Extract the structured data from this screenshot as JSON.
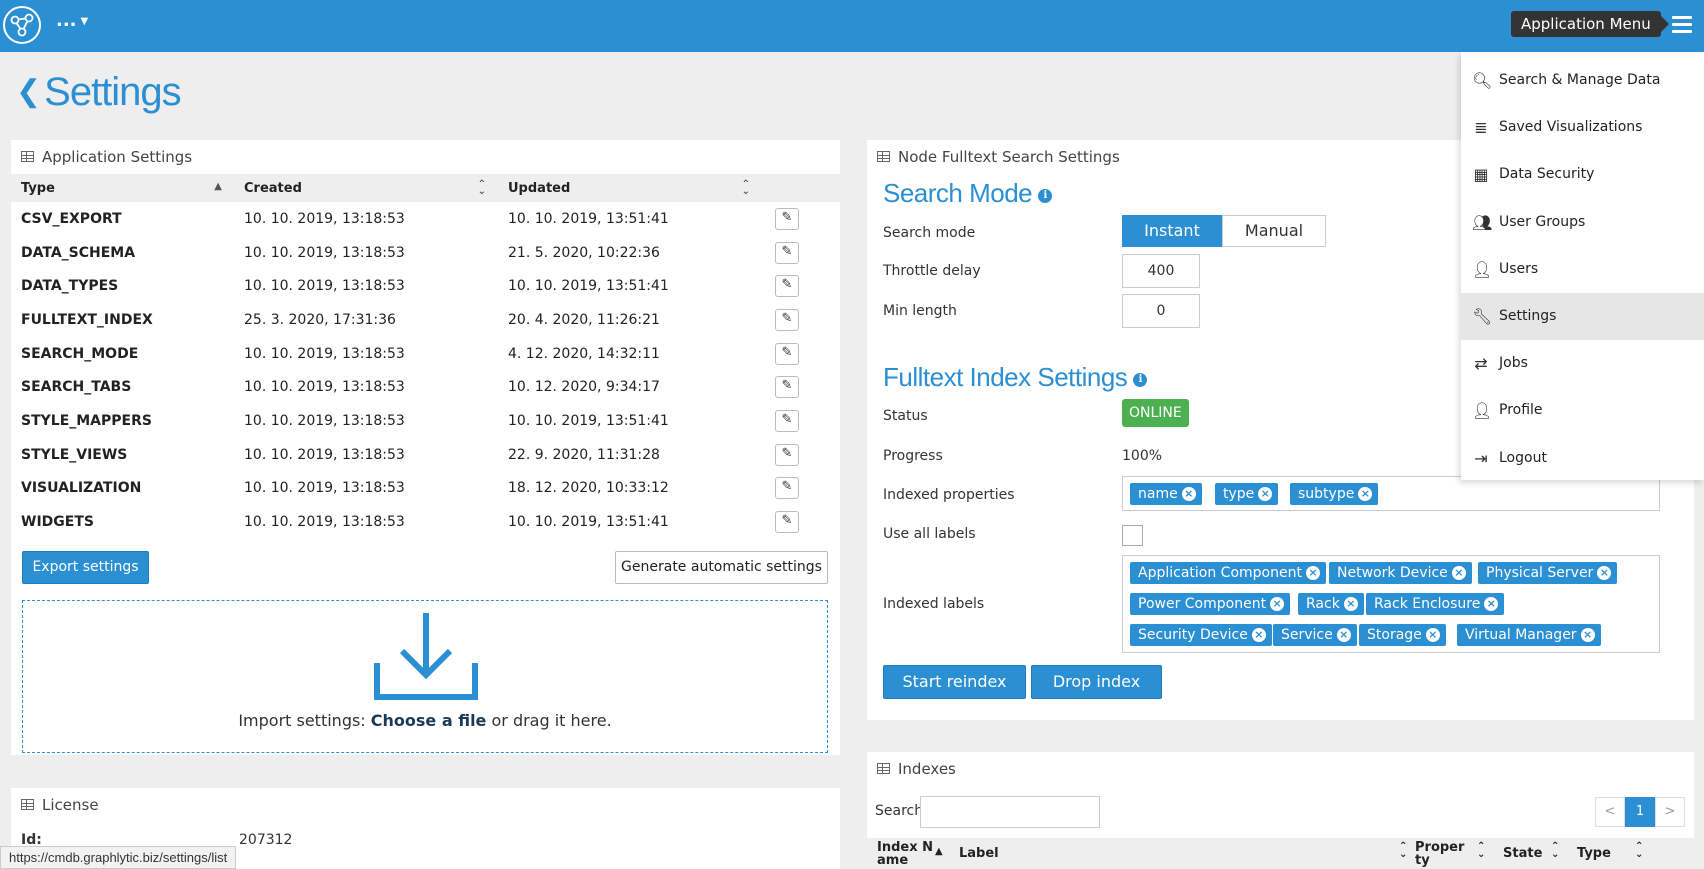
{
  "topbar": {
    "workspace_label": "...",
    "menu_tooltip": "Application Menu"
  },
  "page": {
    "title": "Settings"
  },
  "app_settings": {
    "title": "Application Settings",
    "columns": [
      "Type",
      "Created",
      "Updated"
    ],
    "rows": [
      {
        "type": "CSV_EXPORT",
        "created": "10. 10. 2019, 13:18:53",
        "updated": "10. 10. 2019, 13:51:41"
      },
      {
        "type": "DATA_SCHEMA",
        "created": "10. 10. 2019, 13:18:53",
        "updated": "21. 5. 2020, 10:22:36"
      },
      {
        "type": "DATA_TYPES",
        "created": "10. 10. 2019, 13:18:53",
        "updated": "10. 10. 2019, 13:51:41"
      },
      {
        "type": "FULLTEXT_INDEX",
        "created": "25. 3. 2020, 17:31:36",
        "updated": "20. 4. 2020, 11:26:21"
      },
      {
        "type": "SEARCH_MODE",
        "created": "10. 10. 2019, 13:18:53",
        "updated": "4. 12. 2020, 14:32:11"
      },
      {
        "type": "SEARCH_TABS",
        "created": "10. 10. 2019, 13:18:53",
        "updated": "10. 12. 2020, 9:34:17"
      },
      {
        "type": "STYLE_MAPPERS",
        "created": "10. 10. 2019, 13:18:53",
        "updated": "10. 10. 2019, 13:51:41"
      },
      {
        "type": "STYLE_VIEWS",
        "created": "10. 10. 2019, 13:18:53",
        "updated": "22. 9. 2020, 11:31:28"
      },
      {
        "type": "VISUALIZATION",
        "created": "10. 10. 2019, 13:18:53",
        "updated": "18. 12. 2020, 10:33:12"
      },
      {
        "type": "WIDGETS",
        "created": "10. 10. 2019, 13:18:53",
        "updated": "10. 10. 2019, 13:51:41"
      }
    ],
    "export_label": "Export settings",
    "generate_label": "Generate automatic settings",
    "import_prefix": "Import settings: ",
    "import_choose": "Choose a file",
    "import_suffix": " or drag it here."
  },
  "license": {
    "title": "License",
    "id_label": "Id:",
    "id_value": "207312"
  },
  "fulltext": {
    "panel_title": "Node Fulltext Search Settings",
    "search_mode_title": "Search Mode",
    "search_mode_label": "Search mode",
    "mode_instant": "Instant",
    "mode_manual": "Manual",
    "throttle_label": "Throttle delay",
    "throttle_value": "400",
    "min_length_label": "Min length",
    "min_length_value": "0",
    "index_title": "Fulltext Index Settings",
    "status_label": "Status",
    "status_value": "ONLINE",
    "progress_label": "Progress",
    "progress_value": "100%",
    "indexed_props_label": "Indexed properties",
    "indexed_props": [
      "name",
      "type",
      "subtype"
    ],
    "use_all_labels_label": "Use all labels",
    "indexed_labels_label": "Indexed labels",
    "indexed_labels": [
      "Application Component",
      "Network Device",
      "Physical Server",
      "Power Component",
      "Rack",
      "Rack Enclosure",
      "Security Device",
      "Service",
      "Storage",
      "Virtual Manager"
    ],
    "start_reindex_label": "Start reindex",
    "drop_index_label": "Drop index"
  },
  "indexes": {
    "title": "Indexes",
    "search_label": "Search",
    "search_value": "",
    "columns": [
      "Index N\name",
      "Label",
      "Proper\nty",
      "State",
      "Type"
    ],
    "pager_prev": "<",
    "pager_page": "1",
    "pager_next": ">"
  },
  "menu": {
    "items": [
      {
        "label": "Search & Manage Data",
        "icon": "search-icon"
      },
      {
        "label": "Saved Visualizations",
        "icon": "database-icon"
      },
      {
        "label": "Data Security",
        "icon": "grid-icon"
      },
      {
        "label": "User Groups",
        "icon": "users-icon"
      },
      {
        "label": "Users",
        "icon": "user-icon"
      },
      {
        "label": "Settings",
        "icon": "wrench-icon",
        "active": true
      },
      {
        "label": "Jobs",
        "icon": "exchange-icon"
      },
      {
        "label": "Profile",
        "icon": "user-icon"
      },
      {
        "label": "Logout",
        "icon": "logout-icon"
      }
    ]
  },
  "status_url": "https://cmdb.graphlytic.biz/settings/list",
  "colors": {
    "accent": "#2b8fd3",
    "online": "#4caf50",
    "background": "#eeeeee"
  }
}
